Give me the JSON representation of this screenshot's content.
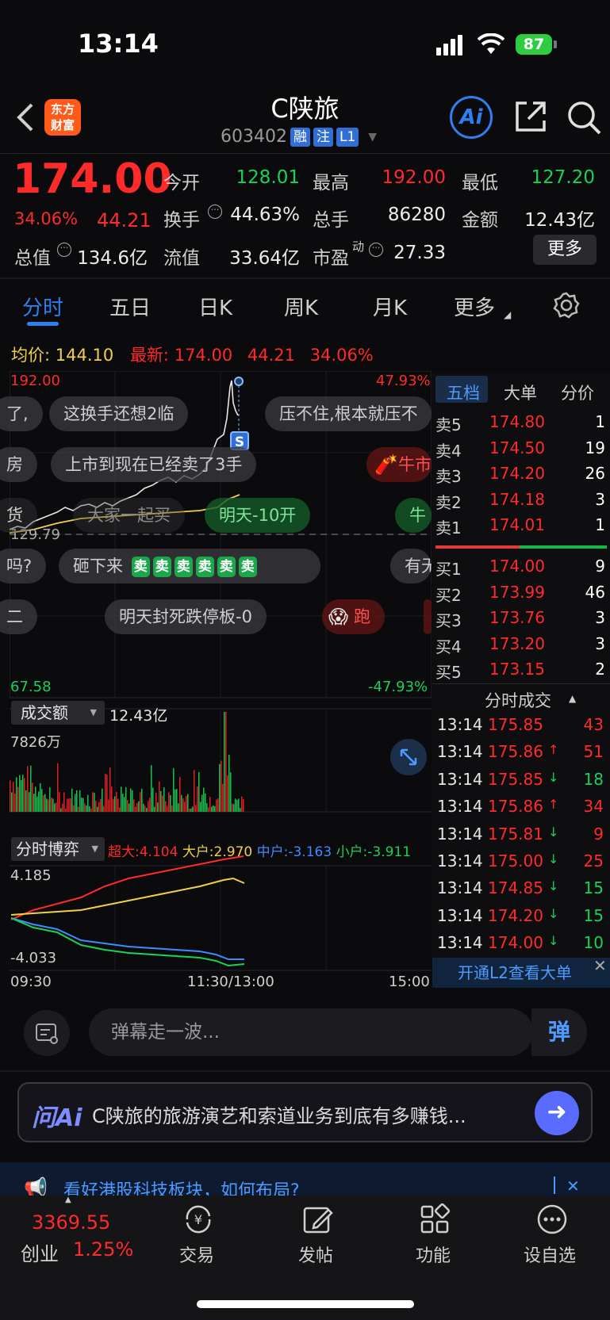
{
  "status": {
    "time": "13:14",
    "battery": "87"
  },
  "header": {
    "logo_line1": "东方",
    "logo_line2": "财富",
    "name": "C陕旅",
    "code": "603402",
    "tags": [
      "融",
      "注",
      "L1"
    ],
    "ai_label": "Ai"
  },
  "quote": {
    "price": "174.00",
    "pct": "34.06%",
    "change": "44.21",
    "open_label": "今开",
    "open": "128.01",
    "high_label": "最高",
    "high": "192.00",
    "low_label": "最低",
    "low": "127.20",
    "turnover_label": "换手",
    "turnover": "44.63%",
    "volume_label": "总手",
    "volume": "86280",
    "amount_label": "金额",
    "amount": "12.43亿",
    "mktcap_label": "总值",
    "mktcap": "134.6亿",
    "float_label": "流值",
    "float": "33.64亿",
    "pe_label": "市盈",
    "pe_sup": "动",
    "pe": "27.33",
    "more": "更多"
  },
  "tabs": [
    "分时",
    "五日",
    "日K",
    "周K",
    "月K",
    "更多"
  ],
  "info_row": {
    "avg_label": "均价:",
    "avg": "144.10",
    "latest_label": "最新:",
    "latest": "174.00",
    "chg": "44.21",
    "pct": "34.06%"
  },
  "chart": {
    "top_price": "192.00",
    "top_pct": "47.93%",
    "mid_price": "129.79",
    "bottom_price": "67.58",
    "bottom_pct": "-47.93%",
    "marker": "S",
    "vol_label": "成交额",
    "vol_total": "12.43亿",
    "vol_max": "7826万",
    "flow_label": "分时博弈",
    "flow_legend": [
      {
        "name": "超大:4.104",
        "color": "#ff2a2a"
      },
      {
        "name": "大户:2.970",
        "color": "#f0d04a"
      },
      {
        "name": "中户:-3.163",
        "color": "#3d8bff"
      },
      {
        "name": "小户:-3.911",
        "color": "#18d15a"
      }
    ],
    "flow_max": "4.185",
    "flow_min": "-4.033",
    "time_start": "09:30",
    "time_mid": "11:30/13:00",
    "time_end": "15:00"
  },
  "danmu": [
    "了,",
    "这换手还想2临",
    "压不住,根本就压不",
    "房",
    "上市到现在已经卖了3手",
    "牛市",
    "货",
    "大家一起买",
    "明天-10开",
    "牛",
    "吗?",
    "砸下来",
    "有无",
    "二",
    "明天封死跌停板-0",
    "跑"
  ],
  "sell_badge": "卖",
  "orderbook": {
    "tabs": [
      "五档",
      "大单",
      "分价"
    ],
    "asks": [
      {
        "label": "卖5",
        "price": "174.80",
        "vol": "1"
      },
      {
        "label": "卖4",
        "price": "174.50",
        "vol": "19"
      },
      {
        "label": "卖3",
        "price": "174.20",
        "vol": "26"
      },
      {
        "label": "卖2",
        "price": "174.18",
        "vol": "3"
      },
      {
        "label": "卖1",
        "price": "174.01",
        "vol": "1"
      }
    ],
    "bids": [
      {
        "label": "买1",
        "price": "174.00",
        "vol": "9"
      },
      {
        "label": "买2",
        "price": "173.99",
        "vol": "46"
      },
      {
        "label": "买3",
        "price": "173.76",
        "vol": "3"
      },
      {
        "label": "买4",
        "price": "173.20",
        "vol": "3"
      },
      {
        "label": "买5",
        "price": "173.15",
        "vol": "2"
      }
    ],
    "ticks_title": "分时成交",
    "ticks": [
      {
        "t": "13:14",
        "p": "175.85",
        "a": "",
        "v": "43",
        "side": "buy"
      },
      {
        "t": "13:14",
        "p": "175.86",
        "a": "↑",
        "v": "51",
        "side": "buy"
      },
      {
        "t": "13:14",
        "p": "175.85",
        "a": "↓",
        "v": "18",
        "side": "sell"
      },
      {
        "t": "13:14",
        "p": "175.86",
        "a": "↑",
        "v": "34",
        "side": "buy"
      },
      {
        "t": "13:14",
        "p": "175.81",
        "a": "↓",
        "v": "9",
        "side": "buy"
      },
      {
        "t": "13:14",
        "p": "175.00",
        "a": "↓",
        "v": "25",
        "side": "buy"
      },
      {
        "t": "13:14",
        "p": "174.85",
        "a": "↓",
        "v": "15",
        "side": "sell"
      },
      {
        "t": "13:14",
        "p": "174.20",
        "a": "↓",
        "v": "15",
        "side": "sell"
      },
      {
        "t": "13:14",
        "p": "174.00",
        "a": "↓",
        "v": "10",
        "side": "sell"
      }
    ],
    "l2": "开通L2查看大单"
  },
  "comment": {
    "placeholder": "弹幕走一波...",
    "toggle": "弹"
  },
  "ask": {
    "logo": "问Ai",
    "text": "C陕旅的旅游演艺和索道业务到底有多赚钱..."
  },
  "news": {
    "text": "看好港股科技板块，如何布局?"
  },
  "bottom": {
    "index_value": "3369.55",
    "index_name": "创业",
    "index_pct": "1.25%",
    "items": [
      "交易",
      "发帖",
      "功能",
      "设自选"
    ]
  }
}
